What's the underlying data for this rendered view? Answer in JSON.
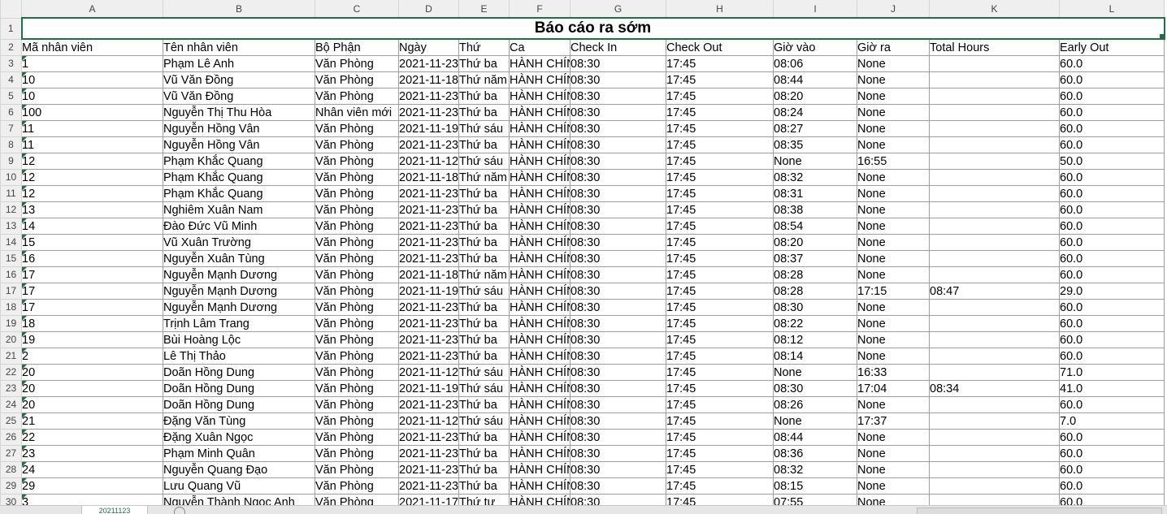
{
  "columns": [
    "A",
    "B",
    "C",
    "D",
    "E",
    "F",
    "G",
    "H",
    "I",
    "J",
    "K",
    "L"
  ],
  "title": "Báo cáo ra sớm",
  "headers": [
    "Mã nhân viên",
    "Tên nhân viên",
    "Bộ Phận",
    "Ngày",
    "Thứ",
    "Ca",
    "Check In",
    "Check Out",
    "Giờ vào",
    "Giờ ra",
    "Total Hours",
    "Early Out"
  ],
  "rows": [
    {
      "num": "3",
      "cells": [
        "1",
        "Phạm Lê Anh",
        "Văn Phòng",
        "2021-11-23",
        "Thứ ba",
        "HÀNH CHÍNH",
        "08:30",
        "17:45",
        "08:06",
        "None",
        "",
        "60.0"
      ]
    },
    {
      "num": "4",
      "cells": [
        "10",
        "Vũ Văn Đồng",
        "Văn Phòng",
        "2021-11-18",
        "Thứ năm",
        "HÀNH CHÍNH",
        "08:30",
        "17:45",
        "08:44",
        "None",
        "",
        "60.0"
      ]
    },
    {
      "num": "5",
      "cells": [
        "10",
        "Vũ Văn Đồng",
        "Văn Phòng",
        "2021-11-23",
        "Thứ ba",
        "HÀNH CHÍNH",
        "08:30",
        "17:45",
        "08:20",
        "None",
        "",
        "60.0"
      ]
    },
    {
      "num": "6",
      "cells": [
        "100",
        "Nguyễn Thị Thu Hòa",
        "Nhân viên mới",
        "2021-11-23",
        "Thứ ba",
        "HÀNH CHÍNH",
        "08:30",
        "17:45",
        "08:24",
        "None",
        "",
        "60.0"
      ]
    },
    {
      "num": "7",
      "cells": [
        "11",
        "Nguyễn Hồng Vân",
        "Văn Phòng",
        "2021-11-19",
        "Thứ sáu",
        "HÀNH CHÍNH",
        "08:30",
        "17:45",
        "08:27",
        "None",
        "",
        "60.0"
      ]
    },
    {
      "num": "8",
      "cells": [
        "11",
        "Nguyễn Hồng Vân",
        "Văn Phòng",
        "2021-11-23",
        "Thứ ba",
        "HÀNH CHÍNH",
        "08:30",
        "17:45",
        "08:35",
        "None",
        "",
        "60.0"
      ]
    },
    {
      "num": "9",
      "cells": [
        "12",
        "Phạm Khắc Quang",
        "Văn Phòng",
        "2021-11-12",
        "Thứ sáu",
        "HÀNH CHÍNH",
        "08:30",
        "17:45",
        "None",
        "16:55",
        "",
        "50.0"
      ]
    },
    {
      "num": "10",
      "cells": [
        "12",
        "Phạm Khắc Quang",
        "Văn Phòng",
        "2021-11-18",
        "Thứ năm",
        "HÀNH CHÍNH",
        "08:30",
        "17:45",
        "08:32",
        "None",
        "",
        "60.0"
      ]
    },
    {
      "num": "11",
      "cells": [
        "12",
        "Phạm Khắc Quang",
        "Văn Phòng",
        "2021-11-23",
        "Thứ ba",
        "HÀNH CHÍNH",
        "08:30",
        "17:45",
        "08:31",
        "None",
        "",
        "60.0"
      ]
    },
    {
      "num": "12",
      "cells": [
        "13",
        "Nghiêm Xuân Nam",
        "Văn Phòng",
        "2021-11-23",
        "Thứ ba",
        "HÀNH CHÍNH",
        "08:30",
        "17:45",
        "08:38",
        "None",
        "",
        "60.0"
      ]
    },
    {
      "num": "13",
      "cells": [
        "14",
        "Đào Đức Vũ Minh",
        "Văn Phòng",
        "2021-11-23",
        "Thứ ba",
        "HÀNH CHÍNH",
        "08:30",
        "17:45",
        "08:54",
        "None",
        "",
        "60.0"
      ]
    },
    {
      "num": "14",
      "cells": [
        "15",
        "Vũ Xuân Trường",
        "Văn Phòng",
        "2021-11-23",
        "Thứ ba",
        "HÀNH CHÍNH",
        "08:30",
        "17:45",
        "08:20",
        "None",
        "",
        "60.0"
      ]
    },
    {
      "num": "15",
      "cells": [
        "16",
        "Nguyễn Xuân Tùng",
        "Văn Phòng",
        "2021-11-23",
        "Thứ ba",
        "HÀNH CHÍNH",
        "08:30",
        "17:45",
        "08:37",
        "None",
        "",
        "60.0"
      ]
    },
    {
      "num": "16",
      "cells": [
        "17",
        "Nguyễn Mạnh Dương",
        "Văn Phòng",
        "2021-11-18",
        "Thứ năm",
        "HÀNH CHÍNH",
        "08:30",
        "17:45",
        "08:28",
        "None",
        "",
        "60.0"
      ]
    },
    {
      "num": "17",
      "cells": [
        "17",
        "Nguyễn Mạnh Dương",
        "Văn Phòng",
        "2021-11-19",
        "Thứ sáu",
        "HÀNH CHÍNH",
        "08:30",
        "17:45",
        "08:28",
        "17:15",
        "08:47",
        "29.0"
      ]
    },
    {
      "num": "18",
      "cells": [
        "17",
        "Nguyễn Mạnh Dương",
        "Văn Phòng",
        "2021-11-23",
        "Thứ ba",
        "HÀNH CHÍNH",
        "08:30",
        "17:45",
        "08:30",
        "None",
        "",
        "60.0"
      ]
    },
    {
      "num": "19",
      "cells": [
        "18",
        "Trịnh Lâm Trang",
        "Văn Phòng",
        "2021-11-23",
        "Thứ ba",
        "HÀNH CHÍNH",
        "08:30",
        "17:45",
        "08:22",
        "None",
        "",
        "60.0"
      ]
    },
    {
      "num": "20",
      "cells": [
        "19",
        "Bùi Hoàng Lộc",
        "Văn Phòng",
        "2021-11-23",
        "Thứ ba",
        "HÀNH CHÍNH",
        "08:30",
        "17:45",
        "08:12",
        "None",
        "",
        "60.0"
      ]
    },
    {
      "num": "21",
      "cells": [
        "2",
        "Lê Thị Thảo",
        "Văn Phòng",
        "2021-11-23",
        "Thứ ba",
        "HÀNH CHÍNH",
        "08:30",
        "17:45",
        "08:14",
        "None",
        "",
        "60.0"
      ]
    },
    {
      "num": "22",
      "cells": [
        "20",
        "Doãn Hồng Dung",
        "Văn Phòng",
        "2021-11-12",
        "Thứ sáu",
        "HÀNH CHÍNH",
        "08:30",
        "17:45",
        "None",
        "16:33",
        "",
        "71.0"
      ]
    },
    {
      "num": "23",
      "cells": [
        "20",
        "Doãn Hồng Dung",
        "Văn Phòng",
        "2021-11-19",
        "Thứ sáu",
        "HÀNH CHÍNH",
        "08:30",
        "17:45",
        "08:30",
        "17:04",
        "08:34",
        "41.0"
      ]
    },
    {
      "num": "24",
      "cells": [
        "20",
        "Doãn Hồng Dung",
        "Văn Phòng",
        "2021-11-23",
        "Thứ ba",
        "HÀNH CHÍNH",
        "08:30",
        "17:45",
        "08:26",
        "None",
        "",
        "60.0"
      ]
    },
    {
      "num": "25",
      "cells": [
        "21",
        "Đặng Văn Tùng",
        "Văn Phòng",
        "2021-11-12",
        "Thứ sáu",
        "HÀNH CHÍNH",
        "08:30",
        "17:45",
        "None",
        "17:37",
        "",
        "7.0"
      ]
    },
    {
      "num": "26",
      "cells": [
        "22",
        "Đặng Xuân Ngọc",
        "Văn Phòng",
        "2021-11-23",
        "Thứ ba",
        "HÀNH CHÍNH",
        "08:30",
        "17:45",
        "08:44",
        "None",
        "",
        "60.0"
      ]
    },
    {
      "num": "27",
      "cells": [
        "23",
        "Phạm Minh Quân",
        "Văn Phòng",
        "2021-11-23",
        "Thứ ba",
        "HÀNH CHÍNH",
        "08:30",
        "17:45",
        "08:36",
        "None",
        "",
        "60.0"
      ]
    },
    {
      "num": "28",
      "cells": [
        "24",
        "Nguyễn Quang Đạo",
        "Văn Phòng",
        "2021-11-23",
        "Thứ ba",
        "HÀNH CHÍNH",
        "08:30",
        "17:45",
        "08:32",
        "None",
        "",
        "60.0"
      ]
    },
    {
      "num": "29",
      "cells": [
        "29",
        "Lưu Quang Vũ",
        "Văn Phòng",
        "2021-11-23",
        "Thứ ba",
        "HÀNH CHÍNH",
        "08:30",
        "17:45",
        "08:15",
        "None",
        "",
        "60.0"
      ]
    },
    {
      "num": "30",
      "cells": [
        "3",
        "Nguyễn Thành Ngọc Anh",
        "Văn Phòng",
        "2021-11-17",
        "Thứ tư",
        "HÀNH CHÍNH",
        "08:30",
        "17:45",
        "07:55",
        "None",
        "",
        "60.0"
      ]
    }
  ],
  "sheet_tab": "20211123",
  "colors": {
    "accent": "#1e7145",
    "grid": "#9e9e9e",
    "header_bg": "#efefef"
  }
}
